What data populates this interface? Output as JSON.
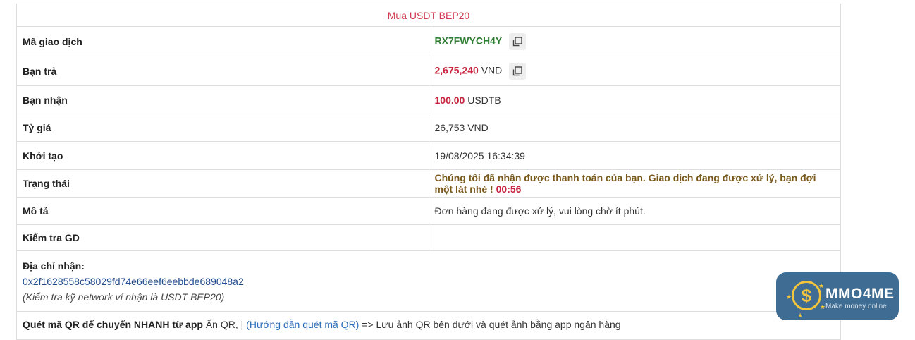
{
  "header": {
    "title": "Mua USDT BEP20"
  },
  "rows": {
    "ma_giao_dich": {
      "label": "Mã giao dịch",
      "value": "RX7FWYCH4Y"
    },
    "ban_tra": {
      "label": "Bạn trả",
      "amount": "2,675,240",
      "unit": "VND"
    },
    "ban_nhan": {
      "label": "Bạn nhận",
      "amount": "100.00",
      "unit": "USDTB"
    },
    "ty_gia": {
      "label": "Tỷ giá",
      "value": "26,753 VND"
    },
    "khoi_tao": {
      "label": "Khởi tạo",
      "value": "19/08/2025 16:34:39"
    },
    "trang_thai": {
      "label": "Trạng thái",
      "message": "Chúng tôi đã nhận được thanh toán của bạn. Giao dịch đang được xử lý, bạn đợi một lát nhé !",
      "countdown": "00:56"
    },
    "mo_ta": {
      "label": "Mô tả",
      "value": "Đơn hàng đang được xử lý, vui lòng chờ ít phút."
    },
    "kiem_tra": {
      "label": "Kiểm tra GD",
      "value": ""
    }
  },
  "address": {
    "label": "Địa chỉ nhận:",
    "value": "0x2f1628558c58029fd74e66eef6eebbde689048a2",
    "note": "(Kiểm tra kỹ network ví nhận là USDT BEP20)"
  },
  "qr_section": {
    "bold_text": "Quét mã QR để chuyển NHANH từ app",
    "text1": "Ấn QR, |",
    "link": "(Hướng dẫn quét mã QR)",
    "text2": "=> Lưu ảnh QR bên dưới và quét ảnh bằng app ngân hàng"
  },
  "logo": {
    "title": "MMO4ME",
    "subtitle": "Make money online",
    "symbol": "$"
  },
  "icons": {
    "copy": "copy-icon"
  },
  "colors": {
    "title": "#d0394f",
    "code": "#2f7d32",
    "amount": "#c8233f",
    "status": "#7a5a1c",
    "logo_bg": "#3f6c92",
    "logo_accent": "#f2c53d"
  }
}
